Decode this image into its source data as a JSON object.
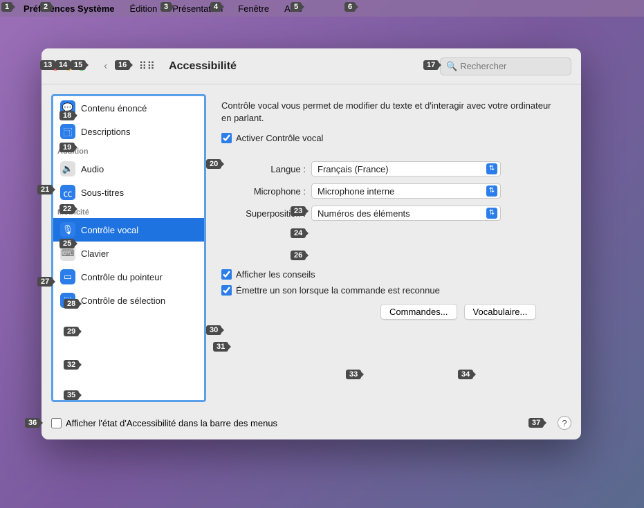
{
  "menubar": {
    "items": [
      "Préférences Système",
      "Édition",
      "Présentation",
      "Fenêtre",
      "Aide"
    ]
  },
  "window": {
    "title": "Accessibilité",
    "search_placeholder": "Rechercher"
  },
  "sidebar": {
    "sections": [
      {
        "header": null,
        "items": [
          {
            "label": "Contenu énoncé",
            "icon": "speak"
          },
          {
            "label": "Descriptions",
            "icon": "desc"
          }
        ]
      },
      {
        "header": "Audition",
        "items": [
          {
            "label": "Audio",
            "icon": "audio",
            "grey": true
          },
          {
            "label": "Sous-titres",
            "icon": "cc"
          }
        ]
      },
      {
        "header": "Motricité",
        "items": [
          {
            "label": "Contrôle vocal",
            "icon": "voice",
            "selected": true
          },
          {
            "label": "Clavier",
            "icon": "keyboard",
            "grey": true
          },
          {
            "label": "Contrôle du pointeur",
            "icon": "pointer"
          },
          {
            "label": "Contrôle de sélection",
            "icon": "switch"
          }
        ]
      }
    ]
  },
  "main": {
    "description": "Contrôle vocal vous permet de modifier du texte et d'interagir avec votre ordinateur en parlant.",
    "enable_label": "Activer Contrôle vocal",
    "enable_checked": true,
    "fields": {
      "language": {
        "label": "Langue :",
        "value": "Français (France)"
      },
      "microphone": {
        "label": "Microphone :",
        "value": "Microphone interne"
      },
      "overlay": {
        "label": "Superposition :",
        "value": "Numéros des éléments"
      }
    },
    "options": {
      "hints": {
        "label": "Afficher les conseils",
        "checked": true
      },
      "sound": {
        "label": "Émettre un son lorsque la commande est reconnue",
        "checked": true
      }
    },
    "buttons": {
      "commands": "Commandes...",
      "vocab": "Vocabulaire..."
    }
  },
  "footer": {
    "show_status_label": "Afficher l'état d'Accessibilité dans la barre des menus",
    "show_status_checked": false
  },
  "tags": {
    "1": "1",
    "2": "2",
    "3": "3",
    "4": "4",
    "5": "5",
    "6": "6",
    "13": "13",
    "14": "14",
    "15": "15",
    "16": "16",
    "17": "17",
    "18": "18",
    "19": "19",
    "20": "20",
    "21": "21",
    "22": "22",
    "23": "23",
    "24": "24",
    "25": "25",
    "27": "27",
    "28": "28",
    "29": "29",
    "30": "30",
    "31": "31",
    "32": "32",
    "33": "33",
    "34": "34",
    "35": "35",
    "36": "36",
    "37": "37",
    "26": "26"
  }
}
